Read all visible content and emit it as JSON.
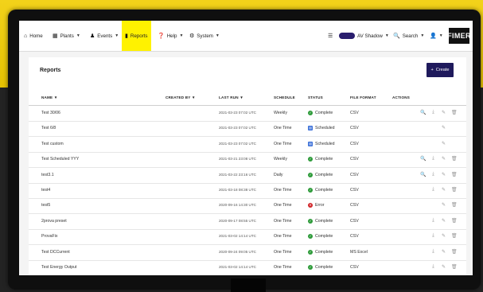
{
  "nav": {
    "home": "Home",
    "plants": "Plants",
    "events": "Events",
    "reports": "Reports",
    "help": "Help",
    "system": "System",
    "user": "AV Shadow",
    "search": "Search",
    "logo": "FIMER"
  },
  "page": {
    "title": "Reports",
    "create_label": "Create"
  },
  "table": {
    "headers": {
      "name": "NAME",
      "created_by": "CREATED BY",
      "last_run": "LAST RUN",
      "schedule": "SCHEDULE",
      "status": "STATUS",
      "file_format": "FILE FORMAT",
      "actions": "ACTIONS"
    },
    "rows": [
      {
        "name": "Test 30/06",
        "last_run": "2021-03-23 07:02 UTC",
        "schedule": "Weekly",
        "status": "Complete",
        "status_type": "ok",
        "format": "CSV",
        "actions": [
          "view",
          "download",
          "edit",
          "delete"
        ]
      },
      {
        "name": "Test 6/8",
        "last_run": "2021-03-23 07:02 UTC",
        "schedule": "One Time",
        "status": "Scheduled",
        "status_type": "sch",
        "format": "CSV",
        "actions": [
          "edit"
        ]
      },
      {
        "name": "Test custom",
        "last_run": "2021-03-23 07:02 UTC",
        "schedule": "One Time",
        "status": "Scheduled",
        "status_type": "sch",
        "format": "CSV",
        "actions": [
          "edit"
        ]
      },
      {
        "name": "Test Scheduled YYY",
        "last_run": "2021-03-21 23:08 UTC",
        "schedule": "Weekly",
        "status": "Complete",
        "status_type": "ok",
        "format": "CSV",
        "actions": [
          "view",
          "download",
          "edit",
          "delete"
        ]
      },
      {
        "name": "test3.1",
        "last_run": "2021-03-22 23:16 UTC",
        "schedule": "Daily",
        "status": "Complete",
        "status_type": "ok",
        "format": "CSV",
        "actions": [
          "view",
          "download",
          "edit",
          "delete"
        ]
      },
      {
        "name": "test4",
        "last_run": "2021-03-18 08:38 UTC",
        "schedule": "One Time",
        "status": "Complete",
        "status_type": "ok",
        "format": "CSV",
        "actions": [
          "download",
          "edit",
          "delete"
        ]
      },
      {
        "name": "test5",
        "last_run": "2020-09-16 14:30 UTC",
        "schedule": "One Time",
        "status": "Error",
        "status_type": "err",
        "format": "CSV",
        "actions": [
          "edit",
          "delete"
        ]
      },
      {
        "name": "2prova preset",
        "last_run": "2020-09-17 08:55 UTC",
        "schedule": "One Time",
        "status": "Complete",
        "status_type": "ok",
        "format": "CSV",
        "actions": [
          "download",
          "edit",
          "delete"
        ]
      },
      {
        "name": "ProvaFix",
        "last_run": "2021-03-02 14:14 UTC",
        "schedule": "One Time",
        "status": "Complete",
        "status_type": "ok",
        "format": "CSV",
        "actions": [
          "download",
          "edit",
          "delete"
        ]
      },
      {
        "name": "Test DCCurrent",
        "last_run": "2020-09-24 09:05 UTC",
        "schedule": "One Time",
        "status": "Complete",
        "status_type": "ok",
        "format": "MS Excel",
        "actions": [
          "download",
          "edit",
          "delete"
        ]
      },
      {
        "name": "Test Energy Output",
        "last_run": "2021-03-02 14:14 UTC",
        "schedule": "One Time",
        "status": "Complete",
        "status_type": "ok",
        "format": "CSV",
        "actions": [
          "download",
          "edit",
          "delete"
        ]
      }
    ]
  },
  "colors": {
    "accent": "#fff200",
    "primary": "#1f1a5c",
    "ok": "#2e9b3a",
    "error": "#d1262a",
    "scheduled": "#3a6fd8"
  }
}
